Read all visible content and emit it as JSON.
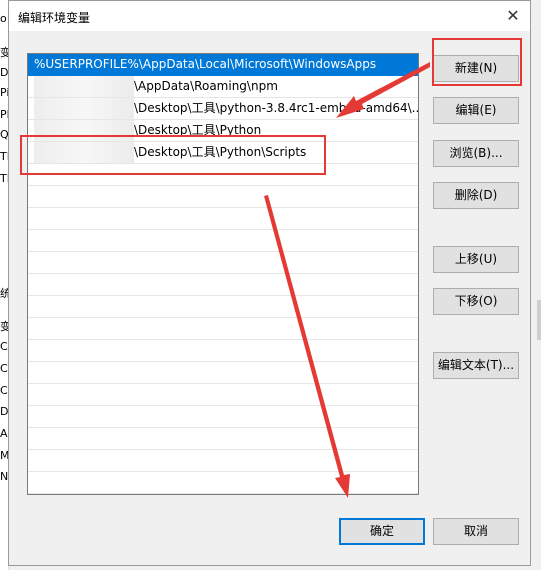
{
  "window": {
    "title": "编辑环境变量",
    "close_glyph": "✕"
  },
  "background_window": {
    "glyphs": [
      "o",
      "变",
      "D",
      "Pi",
      "Pl",
      "Q",
      "TE",
      "TI",
      "统",
      "变",
      "CA",
      "CL",
      "Co",
      "Dr",
      "AI",
      "M",
      "N"
    ]
  },
  "paths": [
    {
      "prefix": "",
      "text": "%USERPROFILE%\\AppData\\Local\\Microsoft\\WindowsApps",
      "selected": true
    },
    {
      "prefix": "blurred",
      "text": "\\AppData\\Roaming\\npm",
      "selected": false
    },
    {
      "prefix": "blurred",
      "text": "\\Desktop\\工具\\python-3.8.4rc1-embed-amd64\\...",
      "selected": false
    },
    {
      "prefix": "blurred",
      "text": "\\Desktop\\工具\\Python",
      "selected": false
    },
    {
      "prefix": "blurred",
      "text": "\\Desktop\\工具\\Python\\Scripts",
      "selected": false
    }
  ],
  "buttons": {
    "new": "新建(N)",
    "edit": "编辑(E)",
    "browse": "浏览(B)...",
    "delete": "删除(D)",
    "move_up": "上移(U)",
    "move_down": "下移(O)",
    "edit_text": "编辑文本(T)...",
    "ok": "确定",
    "cancel": "取消"
  },
  "colors": {
    "selection": "#0078d7",
    "annotation": "#e53935"
  }
}
